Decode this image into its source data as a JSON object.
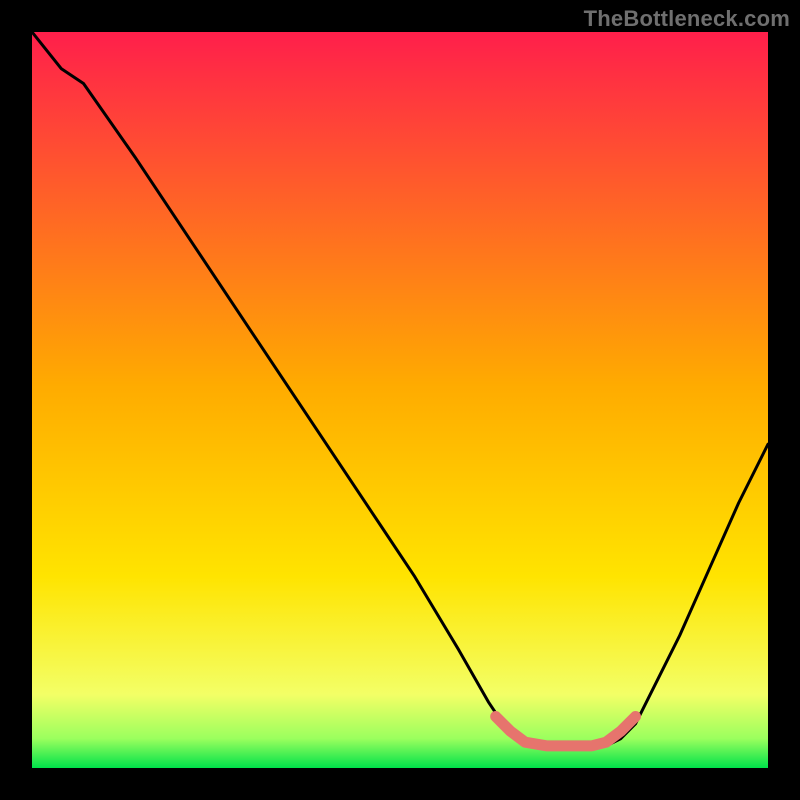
{
  "watermark": "TheBottleneck.com",
  "colors": {
    "gradient_top": "#ff1f4b",
    "gradient_mid": "#ffd400",
    "gradient_bottom": "#00e24a",
    "curve": "#000000",
    "highlight": "#e6746d",
    "frame": "#000000"
  },
  "chart_data": {
    "type": "line",
    "title": "",
    "xlabel": "",
    "ylabel": "",
    "xlim": [
      0,
      100
    ],
    "ylim": [
      0,
      100
    ],
    "curve": {
      "comment": "x in 0..100, y in 0..100, y=0 bottom, y=100 top; bottleneck-style V curve",
      "points": [
        [
          0,
          100
        ],
        [
          4,
          95
        ],
        [
          7,
          93
        ],
        [
          14,
          83
        ],
        [
          22,
          71
        ],
        [
          30,
          59
        ],
        [
          38,
          47
        ],
        [
          46,
          35
        ],
        [
          52,
          26
        ],
        [
          58,
          16
        ],
        [
          62,
          9
        ],
        [
          64,
          6
        ],
        [
          66,
          4
        ],
        [
          68,
          3
        ],
        [
          70,
          3
        ],
        [
          73,
          3
        ],
        [
          76,
          3
        ],
        [
          78,
          3
        ],
        [
          80,
          4
        ],
        [
          82,
          6
        ],
        [
          85,
          12
        ],
        [
          88,
          18
        ],
        [
          92,
          27
        ],
        [
          96,
          36
        ],
        [
          100,
          44
        ]
      ]
    },
    "highlight_segment": {
      "comment": "thick salmon segment along the trough",
      "points": [
        [
          63,
          7
        ],
        [
          65,
          5
        ],
        [
          67,
          3.5
        ],
        [
          70,
          3
        ],
        [
          73,
          3
        ],
        [
          76,
          3
        ],
        [
          78,
          3.5
        ],
        [
          80,
          5
        ],
        [
          82,
          7
        ]
      ]
    }
  }
}
